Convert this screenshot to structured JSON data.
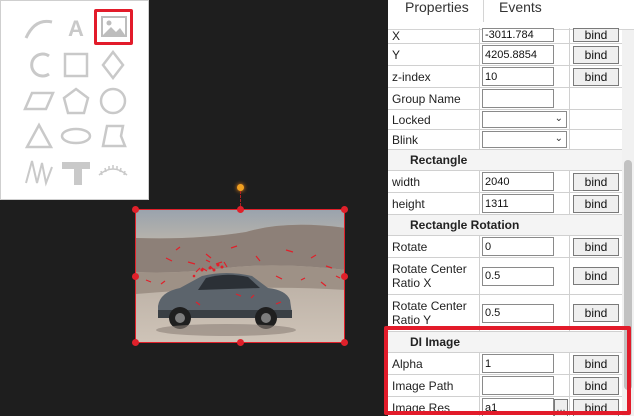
{
  "palette": {
    "letter_tool": "A",
    "tools": [
      "line-tool",
      "text-tool",
      "image-tool",
      "arc-tool",
      "rectangle-tool",
      "diamond-tool",
      "parallelogram-tool",
      "pentagon-tool",
      "circle-tool",
      "triangle-tool",
      "ellipse-tool",
      "trapezoid-tool",
      "waveform-tool",
      "pipe-tool",
      "gauge-tool"
    ],
    "selected": "image-tool"
  },
  "tabs": {
    "properties": "Properties",
    "events": "Events"
  },
  "props": {
    "x": {
      "label": "X",
      "value": "-3011.784",
      "bind": "bind"
    },
    "y": {
      "label": "Y",
      "value": "4205.8854",
      "bind": "bind"
    },
    "zindex": {
      "label": "z-index",
      "value": "10",
      "bind": "bind"
    },
    "group": {
      "label": "Group Name",
      "value": ""
    },
    "locked": {
      "label": "Locked",
      "value": ""
    },
    "blink": {
      "label": "Blink",
      "value": ""
    },
    "section_rect": "Rectangle",
    "width": {
      "label": "width",
      "value": "2040",
      "bind": "bind"
    },
    "height": {
      "label": "height",
      "value": "1311",
      "bind": "bind"
    },
    "section_rot": "Rectangle Rotation",
    "rotate": {
      "label": "Rotate",
      "value": "0",
      "bind": "bind"
    },
    "rcx": {
      "label": "Rotate Center Ratio X",
      "value": "0.5",
      "bind": "bind"
    },
    "rcy": {
      "label": "Rotate Center Ratio Y",
      "value": "0.5",
      "bind": "bind"
    },
    "section_img": "DI Image",
    "alpha": {
      "label": "Alpha",
      "value": "1",
      "bind": "bind"
    },
    "path": {
      "label": "Image Path",
      "value": "",
      "bind": "bind"
    },
    "res": {
      "label": "Image Res",
      "value": "a1",
      "dots": "...",
      "bind": "bind"
    }
  },
  "colors": {
    "highlight": "#e21b2a",
    "selection": "#e0202a",
    "canvas": "#1e1e1e",
    "palette_icon": "#c9c9c9"
  }
}
